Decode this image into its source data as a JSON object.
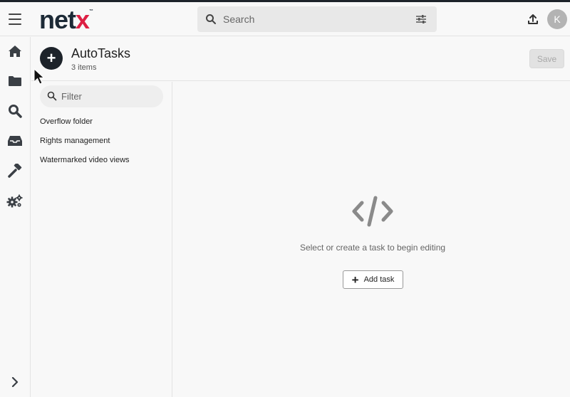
{
  "logo": {
    "text_main": "net",
    "text_accent": "x",
    "accent_color": "#dd1f43",
    "tm": "™"
  },
  "search": {
    "placeholder": "Search"
  },
  "user": {
    "initial": "K"
  },
  "header": {
    "title": "AutoTasks",
    "count": "3 items",
    "save_label": "Save"
  },
  "filter": {
    "placeholder": "Filter"
  },
  "tasks": [
    {
      "label": "Overflow folder"
    },
    {
      "label": "Rights management"
    },
    {
      "label": "Watermarked video views"
    }
  ],
  "empty_state": {
    "message": "Select or create a task to begin editing",
    "add_label": "Add task"
  },
  "icons": {
    "rail": [
      "home-icon",
      "folder-icon",
      "search-icon",
      "inbox-icon",
      "hammer-icon",
      "gears-icon",
      "chevron-right-icon"
    ],
    "topbar": [
      "menu-icon",
      "search-icon",
      "filter-settings-icon",
      "upload-icon"
    ]
  }
}
